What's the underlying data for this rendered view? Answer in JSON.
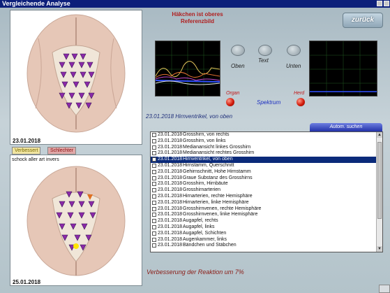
{
  "window": {
    "title": "Vergleichende Analyse"
  },
  "header": {
    "line1": "Häkchen ist oberes",
    "line2": "Referenzbild",
    "back_label": "zurück"
  },
  "top_image": {
    "date": "23.01.2018"
  },
  "bottom_image": {
    "date": "25.01.2018"
  },
  "tabs": {
    "improved": "Verbessert",
    "worse": "Schlechter"
  },
  "note": "schock aller art invers",
  "scope_controls": {
    "oben": "Oben",
    "text": "Text",
    "unten": "Unten"
  },
  "indicators": {
    "organ": "Organ",
    "herd": "Herd",
    "spektrum": "Spektrum"
  },
  "info_line": "23.01.2018 Hirnventrikel, von oben",
  "auto_search_label": "Autom. suchen",
  "list_items": [
    {
      "date": "23.01.2018",
      "label": "Grosshirn, von rechts",
      "selected": false
    },
    {
      "date": "23.01.2018",
      "label": "Grosshirn, von links",
      "selected": false
    },
    {
      "date": "23.01.2018",
      "label": "Medianansicht linkes Grosshirn",
      "selected": false
    },
    {
      "date": "23.01.2018",
      "label": "Medianansicht rechtes Grosshirn",
      "selected": false
    },
    {
      "date": "23.01.2018",
      "label": "Hirnventrikel, von oben",
      "selected": true
    },
    {
      "date": "23.01.2018",
      "label": "Hirnstamm, Querschnitt",
      "selected": false
    },
    {
      "date": "23.01.2018",
      "label": "Gehirnschnitt, Hohe Hirnstamm",
      "selected": false
    },
    {
      "date": "23.01.2018",
      "label": "Graue Substanz des Grosshirns",
      "selected": false
    },
    {
      "date": "23.01.2018",
      "label": "Grosshirn, Hirnbäute",
      "selected": false
    },
    {
      "date": "23.01.2018",
      "label": "Grosshirnarterien",
      "selected": false
    },
    {
      "date": "23.01.2018",
      "label": "Hirnarterien, rechte Hemisphäre",
      "selected": false
    },
    {
      "date": "23.01.2018",
      "label": "Hirnarterien, linke Hemisphäre",
      "selected": false
    },
    {
      "date": "23.01.2018",
      "label": "Grosshirnvenen, rechte Hemisphäre",
      "selected": false
    },
    {
      "date": "23.01.2018",
      "label": "Grosshirnvenen, linke Hemisphäre",
      "selected": false
    },
    {
      "date": "23.01.2018",
      "label": "Augapfel, rechts",
      "selected": false
    },
    {
      "date": "23.01.2018",
      "label": "Augapfel, links",
      "selected": false
    },
    {
      "date": "23.01.2018",
      "label": "Augapfel, Schichten",
      "selected": false
    },
    {
      "date": "23.01.2018",
      "label": "Augenkammer, links",
      "selected": false
    },
    {
      "date": "23.01.2018",
      "label": "Bändchen und Stäbchen",
      "selected": false
    }
  ],
  "status_text": "Verbesserung der Reaktion um 7%",
  "colors": {
    "titlebar": "#0c1f7a",
    "selection": "#0a2a7a",
    "marker": "#8a2aa8",
    "alert": "#c01818"
  }
}
